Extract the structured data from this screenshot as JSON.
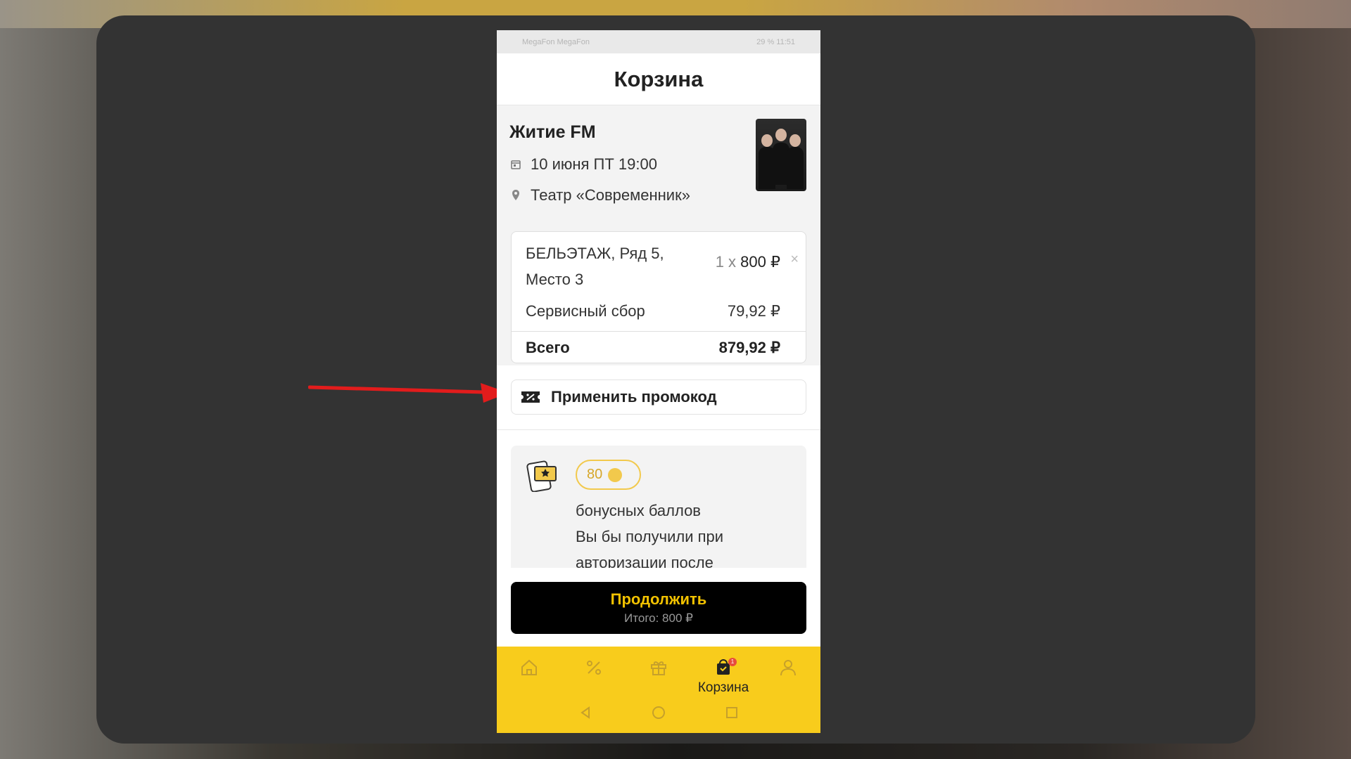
{
  "statusbar": {
    "left": "MegaFon MegaFon",
    "right": "29 % 11:51"
  },
  "header": {
    "title": "Корзина"
  },
  "event": {
    "title": "Житие FM",
    "datetime": "10 июня ПТ 19:00",
    "venue": "Театр «Современник»"
  },
  "order": {
    "seat_line1": "БЕЛЬЭТАЖ, Ряд 5,",
    "seat_line2": "Место 3",
    "qty": "1 x",
    "price": "800 ₽",
    "remove": "×",
    "fee_label": "Сервисный сбор",
    "fee_value": "79,92 ₽",
    "total_label": "Всего",
    "total_value": "879,92 ₽"
  },
  "promo": {
    "label": "Применить промокод"
  },
  "bonus": {
    "points": "80",
    "line1": "бонусных баллов",
    "line2": "Вы бы получили при",
    "line3": "авторизации после"
  },
  "continue": {
    "label": "Продолжить",
    "sub": "Итого: 800 ₽"
  },
  "nav": {
    "cart_label": "Корзина",
    "cart_count": "1"
  },
  "colors": {
    "accent": "#f8cc1c",
    "button": "#000000",
    "arrow": "#e21c1c"
  }
}
